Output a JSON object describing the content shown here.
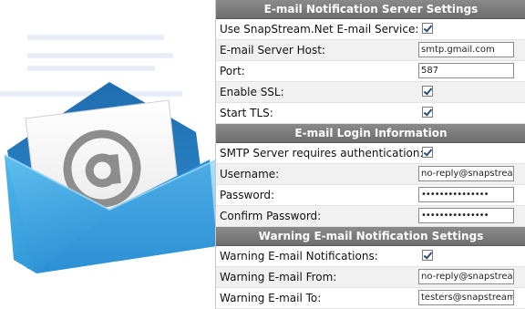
{
  "sections": [
    {
      "title": "E-mail Notification Server Settings",
      "rows": [
        {
          "label": "Use SnapStream.Net E-mail Service:",
          "type": "checkbox",
          "checked": true
        },
        {
          "label": "E-mail Server Host:",
          "type": "text",
          "value": "smtp.gmail.com"
        },
        {
          "label": "Port:",
          "type": "text",
          "value": "587"
        },
        {
          "label": "Enable SSL:",
          "type": "checkbox",
          "checked": true
        },
        {
          "label": "Start TLS:",
          "type": "checkbox",
          "checked": true
        }
      ]
    },
    {
      "title": "E-mail Login Information",
      "rows": [
        {
          "label": "SMTP Server requires authentication:",
          "type": "checkbox",
          "checked": true
        },
        {
          "label": "Username:",
          "type": "text",
          "value": "no-reply@snapstream."
        },
        {
          "label": "Password:",
          "type": "password",
          "value": "•••••••••••••••"
        },
        {
          "label": "Confirm Password:",
          "type": "password",
          "value": "•••••••••••••••"
        }
      ]
    },
    {
      "title": "Warning E-mail Notification Settings",
      "rows": [
        {
          "label": "Warning E-mail Notifications:",
          "type": "checkbox",
          "checked": true
        },
        {
          "label": "Warning E-mail From:",
          "type": "text",
          "value": "no-reply@snapstream."
        },
        {
          "label": "Warning E-mail To:",
          "type": "text",
          "value": "testers@snapstream.co"
        }
      ]
    }
  ],
  "colors": {
    "header_bg": "#7a7a7a",
    "envelope_blue": "#2f8fd0",
    "check": "#2b4e7a"
  },
  "illustration": {
    "icon": "email-envelope-at-icon"
  }
}
